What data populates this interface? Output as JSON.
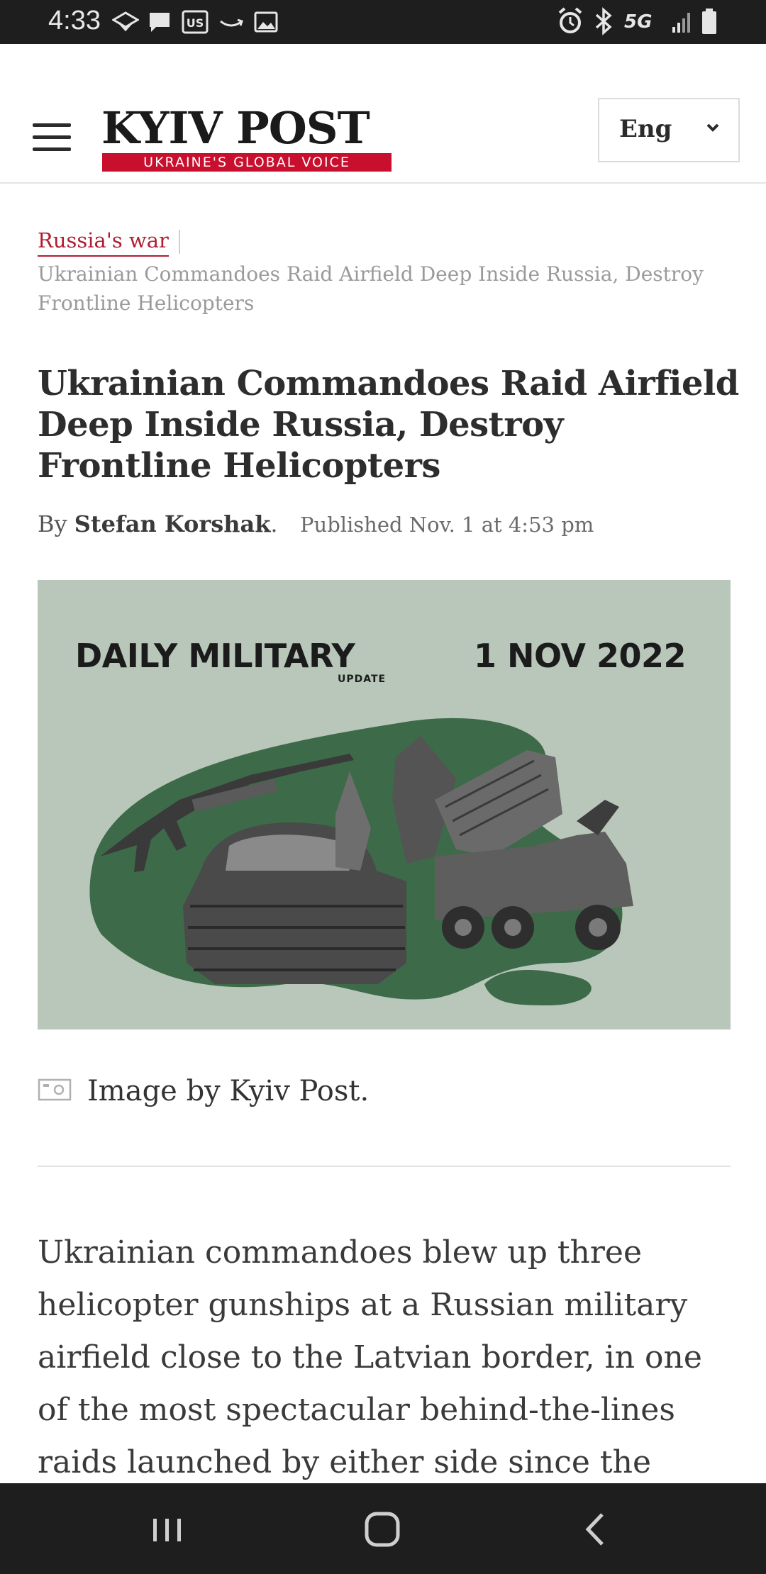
{
  "status_bar": {
    "time": "4:33",
    "network": "5G"
  },
  "header": {
    "logo_text": "KYIV POST",
    "logo_tagline": "UKRAINE'S GLOBAL VOICE",
    "language": "Eng",
    "brand_color": "#c8102e"
  },
  "breadcrumb": {
    "category": "Russia's war",
    "current": "Ukrainian Commandoes Raid Airfield Deep Inside Russia, Destroy Frontline Helicopters"
  },
  "article": {
    "headline": "Ukrainian Commandoes Raid Airfield Deep Inside Russia, Destroy Frontline Helicopters",
    "by_label": "By",
    "author": "Stefan Korshak",
    "author_suffix": ".",
    "published": "Published Nov. 1 at 4:53 pm",
    "hero": {
      "title": "DAILY MILITARY",
      "subtitle": "UPDATE",
      "date": "1 NOV 2022"
    },
    "caption": "Image by Kyiv Post.",
    "body": "Ukrainian commandoes blew up three helicopter gunships at a Russian military airfield close to the Latvian border, in one of the most spectacular behind-the-lines raids launched by either side since the"
  },
  "icons": {
    "menu": "hamburger-menu-icon",
    "dropdown": "chevron-down-icon",
    "caption": "image-icon",
    "nav_recent": "recent-apps-icon",
    "nav_home": "home-icon",
    "nav_back": "back-icon"
  }
}
